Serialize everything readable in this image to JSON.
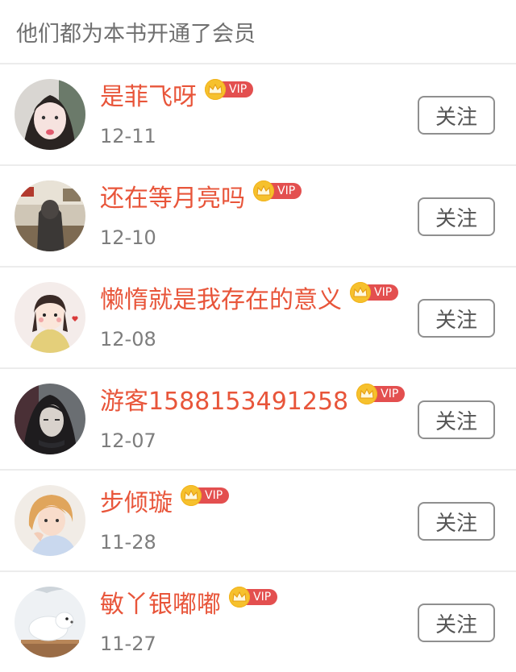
{
  "header": {
    "title": "他们都为本书开通了会员"
  },
  "vip_label": "VIP",
  "follow_label": "关注",
  "colors": {
    "name": "#e8553a",
    "vip_badge": "#e34f4f",
    "crown": "#f6c12d",
    "date": "#7d7d7d",
    "divider": "#ececec"
  },
  "members": [
    {
      "name": "是菲飞呀",
      "date": "12-11",
      "avatar": "girl-portrait"
    },
    {
      "name": "还在等月亮吗",
      "date": "12-10",
      "avatar": "room-photo"
    },
    {
      "name": "懒惰就是我存在的意义",
      "date": "12-08",
      "avatar": "cartoon-girl"
    },
    {
      "name": "游客1588153491258",
      "date": "12-07",
      "avatar": "anime-character"
    },
    {
      "name": "步倾璇",
      "date": "11-28",
      "avatar": "girl-blonde"
    },
    {
      "name": "敏丫银嘟嘟",
      "date": "11-27",
      "avatar": "white-animal"
    }
  ]
}
